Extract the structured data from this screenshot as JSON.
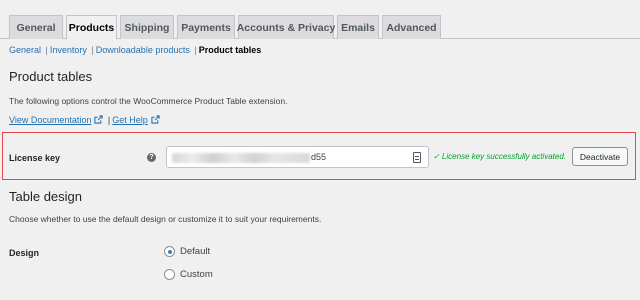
{
  "tabs": [
    {
      "label": "General"
    },
    {
      "label": "Products",
      "active": true
    },
    {
      "label": "Shipping"
    },
    {
      "label": "Payments"
    },
    {
      "label": "Accounts & Privacy"
    },
    {
      "label": "Emails"
    },
    {
      "label": "Advanced"
    }
  ],
  "subnav": {
    "items": [
      "General",
      "Inventory",
      "Downloadable products",
      "Product tables"
    ],
    "separator": "|",
    "current_index": 3
  },
  "product_tables": {
    "heading": "Product tables",
    "description": "The following options control the WooCommerce Product Table extension.",
    "view_docs": "View Documentation",
    "get_help": "Get Help",
    "separator": "|"
  },
  "license": {
    "label": "License key",
    "help": "?",
    "visible_tail": "d55",
    "status": "✓ License key successfully activated.",
    "button": "Deactivate"
  },
  "table_design": {
    "heading": "Table design",
    "description": "Choose whether to use the default design or customize it to suit your requirements.",
    "label": "Design",
    "options": [
      {
        "label": "Default",
        "checked": true
      },
      {
        "label": "Custom",
        "checked": false
      }
    ]
  },
  "colors": {
    "accent": "#2271b1",
    "success": "#00a32a",
    "highlight_border": "#e5484d"
  }
}
